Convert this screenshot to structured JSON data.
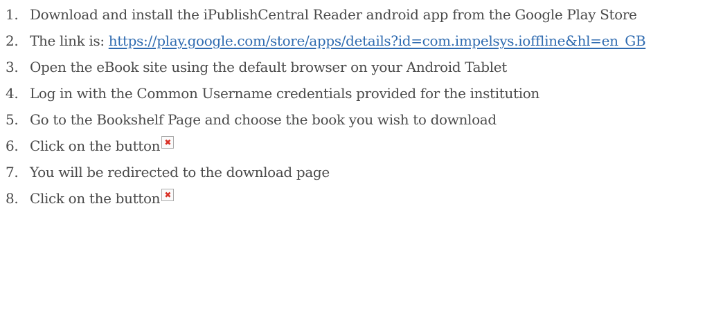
{
  "steps": [
    {
      "num": "1.",
      "text": "Download and install the iPublishCentral Reader android app from the Google Play Store"
    },
    {
      "num": "2.",
      "text": "The link is: ",
      "link": "https://play.google.com/store/apps/details?id=com.impelsys.ioffline&hl=en_GB"
    },
    {
      "num": "3.",
      "text": "Open the eBook site using the default browser on your Android Tablet"
    },
    {
      "num": "4.",
      "text": "Log in with the Common Username credentials provided for the institution"
    },
    {
      "num": "5.",
      "text": "Go to the Bookshelf Page and choose the book you wish to download"
    },
    {
      "num": "6.",
      "text": "Click on the button",
      "image": "broken-image-icon"
    },
    {
      "num": "7.",
      "text": "You will be redirected to the download page"
    },
    {
      "num": "8.",
      "text": "Click on the button",
      "image": "broken-image-icon"
    }
  ],
  "colors": {
    "text": "#4a4a4a",
    "link": "#2f6bb0",
    "broken_image_x": "#d93025"
  }
}
